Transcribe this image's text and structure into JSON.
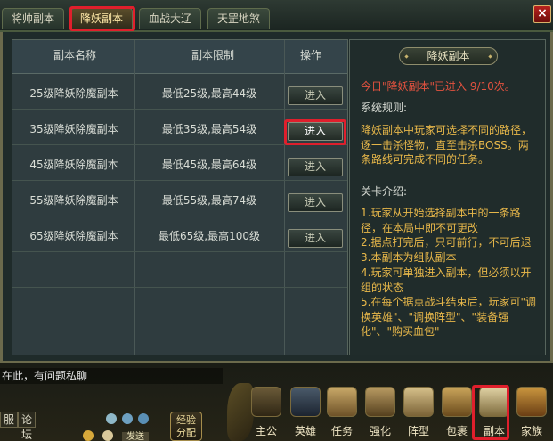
{
  "tabs": [
    {
      "label": "将帅副本",
      "active": false
    },
    {
      "label": "降妖副本",
      "active": true
    },
    {
      "label": "血战大辽",
      "active": false
    },
    {
      "label": "天罡地煞",
      "active": false
    }
  ],
  "close_label": "×",
  "table": {
    "headers": [
      "副本名称",
      "副本限制",
      "操作"
    ],
    "rows": [
      {
        "name": "25级降妖除魔副本",
        "limit": "最低25级,最高44级",
        "action": "进入"
      },
      {
        "name": "35级降妖除魔副本",
        "limit": "最低35级,最高54级",
        "action": "进入"
      },
      {
        "name": "45级降妖除魔副本",
        "limit": "最低45级,最高64级",
        "action": "进入"
      },
      {
        "name": "55级降妖除魔副本",
        "limit": "最低55级,最高74级",
        "action": "进入"
      },
      {
        "name": "65级降妖除魔副本",
        "limit": "最低65级,最高100级",
        "action": "进入"
      }
    ]
  },
  "info": {
    "title": "降妖副本",
    "today": "今日\"降妖副本\"已进入 9/10次。",
    "rules_heading": "系统规则:",
    "rules_body": "降妖副本中玩家可选择不同的路径，逐一击杀怪物，直至击杀BOSS。两条路线可完成不同的任务。",
    "levels_heading": "关卡介绍:",
    "levels": [
      "1.玩家从开始选择副本中的一条路径，在本局中即不可更改",
      "2.据点打完后，只可前行，不可后退",
      "3.本副本为组队副本",
      "4.玩家可单独进入副本，但必须以开组的状态",
      "5.在每个据点战斗结束后，玩家可\"调换英雄\"、\"调换阵型\"、\"装备强化\"、\"购买血包\""
    ]
  },
  "chat": {
    "message": "在此，有问题私聊",
    "tabs": [
      "服",
      "论坛"
    ],
    "exp_label_1": "经验",
    "exp_label_2": "分配",
    "send_label": "发送"
  },
  "menu": [
    {
      "label": "主公",
      "icon": "lord-icon"
    },
    {
      "label": "英雄",
      "icon": "hero-icon"
    },
    {
      "label": "任务",
      "icon": "quest-icon"
    },
    {
      "label": "强化",
      "icon": "hammer-icon"
    },
    {
      "label": "阵型",
      "icon": "formation-icon"
    },
    {
      "label": "包裹",
      "icon": "bag-icon"
    },
    {
      "label": "副本",
      "icon": "dungeon-icon"
    },
    {
      "label": "家族",
      "icon": "family-icon"
    }
  ],
  "colors": {
    "highlight": "#e01f2c",
    "today_text": "#e4523f",
    "info_text": "#e8b84a"
  }
}
